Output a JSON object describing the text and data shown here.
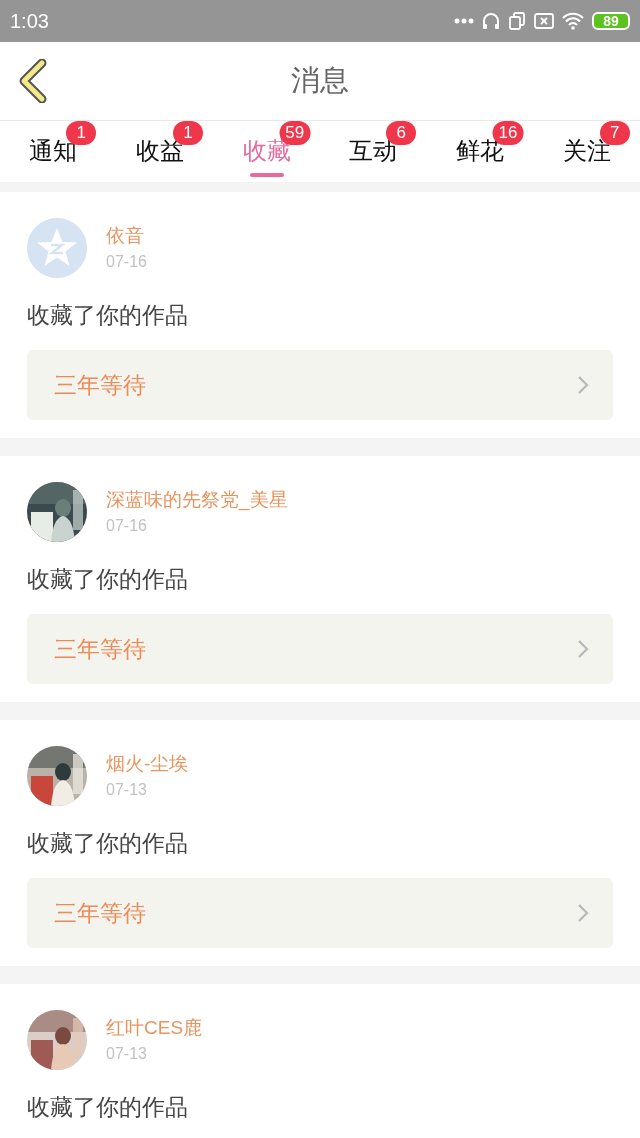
{
  "status_bar": {
    "time": "1:03",
    "battery": "89"
  },
  "header": {
    "title": "消息"
  },
  "tabs": [
    {
      "label": "通知",
      "badge": "1",
      "selected": false
    },
    {
      "label": "收益",
      "badge": "1",
      "selected": false
    },
    {
      "label": "收藏",
      "badge": "59",
      "selected": true
    },
    {
      "label": "互动",
      "badge": "6",
      "selected": false
    },
    {
      "label": "鲜花",
      "badge": "16",
      "selected": false
    },
    {
      "label": "关注",
      "badge": "7",
      "selected": false
    }
  ],
  "messages": [
    {
      "avatar": {
        "kind": "default"
      },
      "name": "依音",
      "date": "07-16",
      "text": "收藏了你的作品",
      "work": "三年等待"
    },
    {
      "name": "深蓝味的先祭党_美星",
      "date": "07-16",
      "text": "收藏了你的作品",
      "work": "三年等待"
    },
    {
      "name": "烟火-尘埃",
      "date": "07-13",
      "text": "收藏了你的作品",
      "work": "三年等待"
    },
    {
      "name": "红叶CES鹿",
      "date": "07-13",
      "text": "收藏了你的作品"
    }
  ]
}
